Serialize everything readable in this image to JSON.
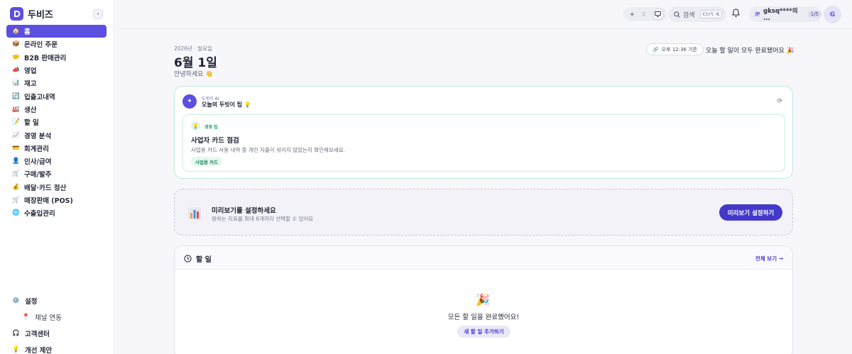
{
  "app": {
    "name": "두비즈"
  },
  "sidebar": {
    "items": [
      {
        "icon": "house-icon",
        "glyph": "🏠",
        "label": "홈",
        "active": true
      },
      {
        "icon": "box-icon",
        "glyph": "📦",
        "label": "온라인 주문"
      },
      {
        "icon": "handshake-icon",
        "glyph": "🤝",
        "label": "B2B 판매관리"
      },
      {
        "icon": "megaphone-icon",
        "glyph": "📣",
        "label": "영업"
      },
      {
        "icon": "chart-icon",
        "glyph": "📊",
        "label": "재고"
      },
      {
        "icon": "inout-icon",
        "glyph": "🔄",
        "label": "입출고내역"
      },
      {
        "icon": "factory-icon",
        "glyph": "🏭",
        "label": "생산"
      },
      {
        "icon": "memo-icon",
        "glyph": "📝",
        "label": "할 일"
      },
      {
        "icon": "analytics-icon",
        "glyph": "📈",
        "label": "경영 분석"
      },
      {
        "icon": "card-icon",
        "glyph": "💳",
        "label": "회계관리"
      },
      {
        "icon": "person-icon",
        "glyph": "👤",
        "label": "인사/급여"
      },
      {
        "icon": "cart-icon",
        "glyph": "🛒",
        "label": "구매/발주"
      },
      {
        "icon": "moneybag-icon",
        "glyph": "💰",
        "label": "배달·카드 정산"
      },
      {
        "icon": "pos-icon",
        "glyph": "🛒",
        "label": "매장판매 (POS)"
      },
      {
        "icon": "globe-icon",
        "glyph": "🌐",
        "label": "수출입관리"
      }
    ],
    "bottom": {
      "settings": "설정",
      "channel": "채널 연동",
      "support": "고객센터",
      "feedback": "개선 제안"
    }
  },
  "header": {
    "search_label": "검색",
    "search_shortcut": "Ctrl K",
    "user_name": "gksq****의 ...",
    "user_badge": "1/5",
    "avatar_letter": "G"
  },
  "main": {
    "date_line": "2026년 · 월요일",
    "title": "6월 1일",
    "greeting": "안녕하세요 👋",
    "time_chip": "오후 12:36 기준",
    "done_message": "오늘 할 일이 모두 완료됐어요 🎉"
  },
  "ai_card": {
    "kicker": "두빗이 AI",
    "title": "오늘의 두빗이 팁 💡",
    "tip_category": "경영 팁",
    "tip_title": "사업자 카드 점검",
    "tip_desc": "사업용 카드 사용 내역 중 개인 지출이 섞이지 않았는지 확인해보세요.",
    "tip_tag": "사업용 카드"
  },
  "preview_card": {
    "title": "미리보기를 설정하세요",
    "desc": "원하는 지표를 최대 6개까지 선택할 수 있어요",
    "button": "미리보기 설정하기"
  },
  "todo_card": {
    "title": "할 일",
    "view_all": "전체 보기 →",
    "empty_emoji": "🎉",
    "empty_text": "모든 할 일을 완료했어요!",
    "add_button": "새 할 일 추가하기"
  }
}
